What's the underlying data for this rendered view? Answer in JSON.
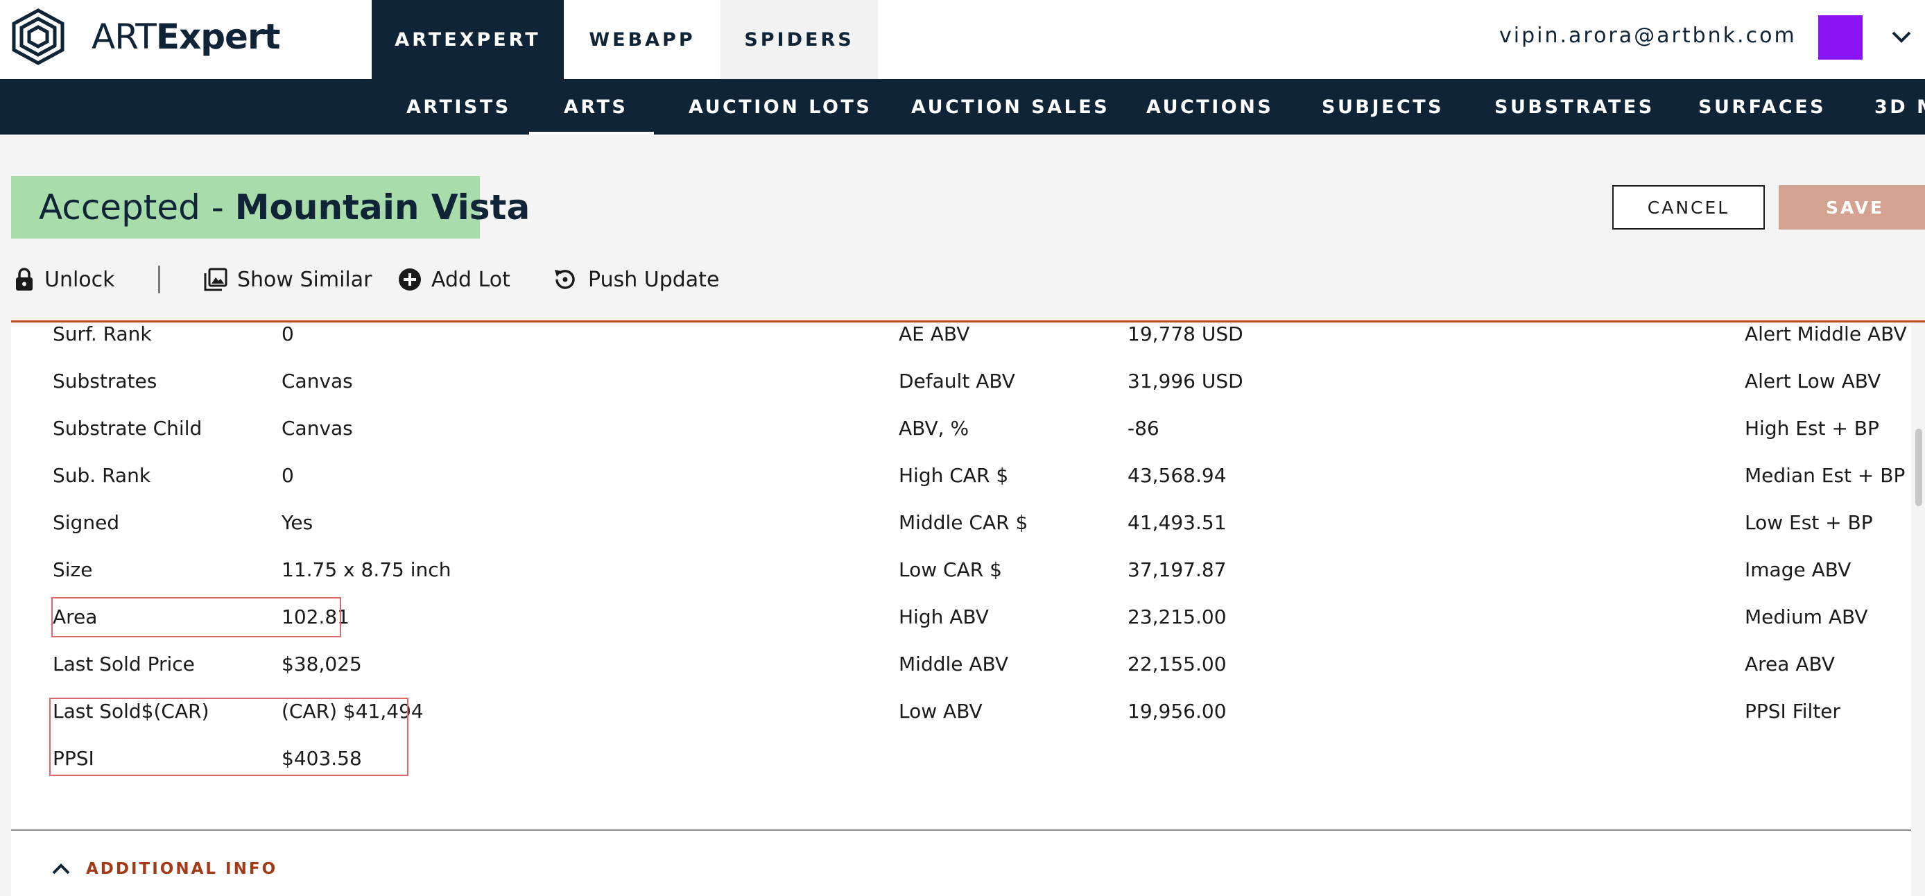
{
  "brand": {
    "prefix": "ART",
    "suffix": "Expert"
  },
  "top_tabs": [
    "ARTEXPERT",
    "WEBAPP",
    "SPIDERS"
  ],
  "user": {
    "email": "vipin.arora@artbnk.com",
    "avatar_color": "#8b14f5"
  },
  "nav": [
    "ARTISTS",
    "ARTS",
    "AUCTION LOTS",
    "AUCTION SALES",
    "AUCTIONS",
    "SUBJECTS",
    "SUBSTRATES",
    "SURFACES",
    "3D M"
  ],
  "nav_active": "ARTS",
  "status": {
    "prefix": "Accepted - ",
    "title": "Mountain Vista",
    "color": "#a8dcaa"
  },
  "buttons": {
    "cancel": "CANCEL",
    "save": "SAVE"
  },
  "actions": {
    "unlock": "Unlock",
    "show_similar": "Show Similar",
    "add_lot": "Add Lot",
    "push_update": "Push Update"
  },
  "col1": [
    {
      "label": "Surf. Rank",
      "value": "0"
    },
    {
      "label": "Substrates",
      "value": "Canvas"
    },
    {
      "label": "Substrate Child",
      "value": "Canvas"
    },
    {
      "label": "Sub. Rank",
      "value": "0"
    },
    {
      "label": "Signed",
      "value": "Yes"
    },
    {
      "label": "Size",
      "value": "11.75 x 8.75 inch"
    },
    {
      "label": "Area",
      "value": "102.81"
    },
    {
      "label": "Last Sold Price",
      "value": "$38,025"
    },
    {
      "label": "Last Sold$(CAR)",
      "value": "(CAR) $41,494"
    },
    {
      "label": "PPSI",
      "value": "$403.58"
    }
  ],
  "col2": [
    {
      "label": "AE ABV",
      "value": "19,778 USD"
    },
    {
      "label": "Default ABV",
      "value": "31,996 USD"
    },
    {
      "label": "ABV, %",
      "value": "-86"
    },
    {
      "label": "High CAR $",
      "value": "43,568.94"
    },
    {
      "label": "Middle CAR $",
      "value": "41,493.51"
    },
    {
      "label": "Low CAR $",
      "value": "37,197.87"
    },
    {
      "label": "High ABV",
      "value": "23,215.00"
    },
    {
      "label": "Middle ABV",
      "value": "22,155.00"
    },
    {
      "label": "Low ABV",
      "value": "19,956.00"
    }
  ],
  "col3": [
    "Alert Middle ABV",
    "Alert Low ABV",
    "High Est + BP",
    "Median Est + BP",
    "Low Est + BP",
    "Image ABV",
    "Medium ABV",
    "Area ABV",
    "PPSI Filter"
  ],
  "additional_info": "ADDITIONAL INFO",
  "accent_colors": {
    "navy": "#0f2436",
    "highlight_border": "#e0666a",
    "section_accent": "#a53a17",
    "save_disabled": "#d4a291"
  }
}
